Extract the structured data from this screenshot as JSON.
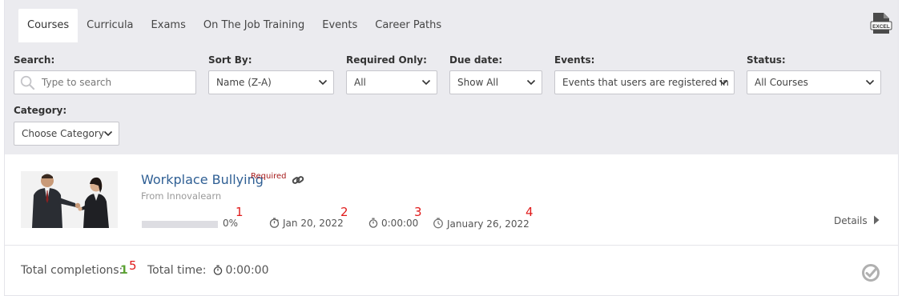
{
  "tabs": [
    {
      "label": "Courses",
      "active": true
    },
    {
      "label": "Curricula",
      "active": false
    },
    {
      "label": "Exams",
      "active": false
    },
    {
      "label": "On The Job Training",
      "active": false
    },
    {
      "label": "Events",
      "active": false
    },
    {
      "label": "Career Paths",
      "active": false
    }
  ],
  "toolbar": {
    "export_icon": "excel-export-icon",
    "export_badge": "EXCEL"
  },
  "filters": {
    "search": {
      "label": "Search:",
      "placeholder": "Type to search"
    },
    "sort_by": {
      "label": "Sort By:",
      "value": "Name (Z-A)"
    },
    "required_only": {
      "label": "Required Only:",
      "value": "All"
    },
    "due_date": {
      "label": "Due date:",
      "value": "Show All"
    },
    "events": {
      "label": "Events:",
      "value": "Events that users are registered in"
    },
    "status": {
      "label": "Status:",
      "value": "All Courses"
    },
    "category": {
      "label": "Category:",
      "value": "Choose Category"
    }
  },
  "course": {
    "title": "Workplace Bullying",
    "required_label": "Required",
    "from": "From Innovalearn",
    "progress_percent": 0,
    "progress_text": "0%",
    "start_date": "Jan 20, 2022",
    "time_spent": "0:00:00",
    "due_date": "January 26, 2022",
    "details_label": "Details"
  },
  "annotations": [
    "1",
    "2",
    "3",
    "4",
    "5"
  ],
  "footer": {
    "total_completions_label": "Total completions:",
    "total_completions_value": "1",
    "total_time_label": "Total time:",
    "total_time_value": "0:00:00"
  },
  "colors": {
    "accent": "#2f5f94",
    "required": "#a61b1b",
    "completion": "#5aa132",
    "annotation": "#e01b1b",
    "header_bg": "#ebebef"
  }
}
